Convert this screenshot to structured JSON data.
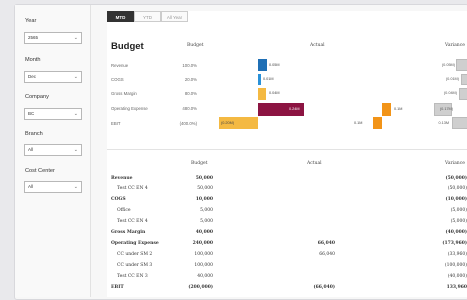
{
  "filters": [
    {
      "label": "Year",
      "value": "2565"
    },
    {
      "label": "Month",
      "value": "Dec"
    },
    {
      "label": "Company",
      "value": "BC"
    },
    {
      "label": "Branch",
      "value": "All"
    },
    {
      "label": "Cost Center",
      "value": "All"
    }
  ],
  "tabs": [
    "MTD",
    "YTD",
    "All Year"
  ],
  "title": "Budget",
  "headers": {
    "budget": "Budget",
    "actual": "Actual",
    "variance": "Variance"
  },
  "chart_rows": [
    {
      "label": "Revenue",
      "pct": "100.0%",
      "budget_label": "0.05M",
      "variance_label": "(0.05M)"
    },
    {
      "label": "COGS",
      "pct": "20.0%",
      "budget_label": "0.01M",
      "variance_label": "(0.01M)"
    },
    {
      "label": "Gross Margin",
      "pct": "80.0%",
      "budget_label": "0.04M",
      "variance_label": "(0.04M)"
    },
    {
      "label": "Operating Expense",
      "pct": "480.0%",
      "budget_label": "0.24M",
      "actual_label": "0.1M",
      "variance_label": "(0.17M)"
    },
    {
      "label": "EBIT",
      "pct": "(400.0%)",
      "budget_label": "(0.20M)",
      "actual_label": "0.1M",
      "variance_label": "0.13M"
    }
  ],
  "colors": {
    "revenue": "#1f6fb5",
    "cogs": "#2a91d8",
    "gross_margin": "#f4b942",
    "opex": "#8c1442",
    "ebit": "#f4b942",
    "actual": "#f29418",
    "variance_box": "#cfcfcf"
  },
  "table_headers": {
    "budget": "Budget",
    "actual": "Actual",
    "variance": "Variance"
  },
  "table_rows": [
    {
      "label": "Revenue",
      "bold": true,
      "indent": 0,
      "budget": "50,000",
      "actual": "",
      "variance": "(50,000)"
    },
    {
      "label": "Test CC EN 4",
      "bold": false,
      "indent": 1,
      "budget": "50,000",
      "actual": "",
      "variance": "(50,000)"
    },
    {
      "label": "COGS",
      "bold": true,
      "indent": 0,
      "budget": "10,000",
      "actual": "",
      "variance": "(10,000)"
    },
    {
      "label": "Office",
      "bold": false,
      "indent": 1,
      "budget": "5,000",
      "actual": "",
      "variance": "(5,000)"
    },
    {
      "label": "Test CC EN 4",
      "bold": false,
      "indent": 1,
      "budget": "5,000",
      "actual": "",
      "variance": "(5,000)"
    },
    {
      "label": "Gross Margin",
      "bold": true,
      "indent": 0,
      "budget": "40,000",
      "actual": "",
      "variance": "(40,000)"
    },
    {
      "label": "Operating Expense",
      "bold": true,
      "indent": 0,
      "budget": "240,000",
      "actual": "66,040",
      "variance": "(173,960)"
    },
    {
      "label": "CC under SM 2",
      "bold": false,
      "indent": 1,
      "budget": "100,000",
      "actual": "66,040",
      "variance": "(33,960)"
    },
    {
      "label": "CC under SM 3",
      "bold": false,
      "indent": 1,
      "budget": "100,000",
      "actual": "",
      "variance": "(100,000)"
    },
    {
      "label": "Test CC EN 3",
      "bold": false,
      "indent": 1,
      "budget": "40,000",
      "actual": "",
      "variance": "(40,000)"
    },
    {
      "label": "EBIT",
      "bold": true,
      "indent": 0,
      "budget": "(200,000)",
      "actual": "(66,040)",
      "variance": "133,960"
    }
  ]
}
